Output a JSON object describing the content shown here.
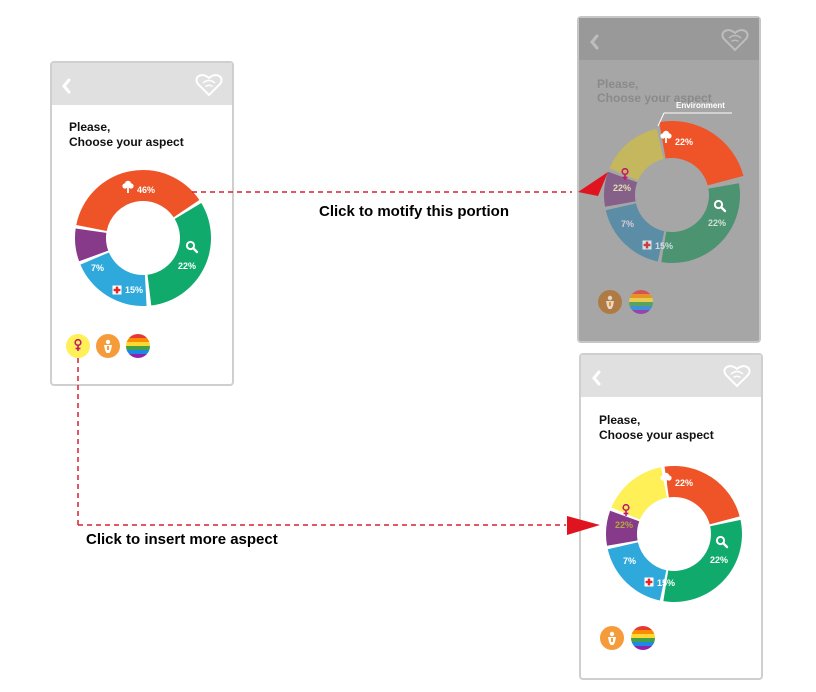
{
  "colors": {
    "environment": "#ef5428",
    "search": "#10ab6c",
    "health": "#2fa9dc",
    "purple": "#883a8a",
    "female": "#fef056",
    "child": "#f69b39",
    "header": "#e0e0e0",
    "frame": "#cfcfcf",
    "arrow": "#d9202f"
  },
  "screens": [
    {
      "prompt_line1": "Please,",
      "prompt_line2": "Choose your aspect",
      "segments": [
        {
          "name": "environment",
          "value": "46%",
          "icon": "tree-icon"
        },
        {
          "name": "search",
          "value": "22%",
          "icon": "magnifier-icon"
        },
        {
          "name": "health",
          "value": "15%",
          "icon": "red-cross-icon"
        },
        {
          "name": "purple",
          "value": "7%",
          "icon": ""
        }
      ],
      "palette": [
        "female-symbol-icon",
        "child-icon",
        "rainbow-icon"
      ]
    },
    {
      "prompt_line1": "Please,",
      "prompt_line2": "Choose your aspect",
      "tooltip": "Environment",
      "segments": [
        {
          "name": "environment",
          "value": "22%",
          "icon": "tree-icon"
        },
        {
          "name": "search",
          "value": "22%",
          "icon": "magnifier-icon"
        },
        {
          "name": "health",
          "value": "15%",
          "icon": "red-cross-icon"
        },
        {
          "name": "purple",
          "value": "7%",
          "icon": ""
        },
        {
          "name": "female",
          "value": "22%",
          "icon": "female-symbol-icon"
        }
      ],
      "palette": [
        "child-icon",
        "rainbow-icon"
      ]
    },
    {
      "prompt_line1": "Please,",
      "prompt_line2": "Choose your aspect",
      "segments": [
        {
          "name": "environment",
          "value": "22%",
          "icon": "tree-icon"
        },
        {
          "name": "search",
          "value": "22%",
          "icon": "magnifier-icon"
        },
        {
          "name": "health",
          "value": "15%",
          "icon": "red-cross-icon"
        },
        {
          "name": "purple",
          "value": "7%",
          "icon": ""
        },
        {
          "name": "female",
          "value": "22%",
          "icon": "female-symbol-icon"
        }
      ],
      "palette": [
        "child-icon",
        "rainbow-icon"
      ]
    }
  ],
  "annotations": {
    "modify": "Click to motify this portion",
    "insert": "Click to insert more aspect"
  }
}
